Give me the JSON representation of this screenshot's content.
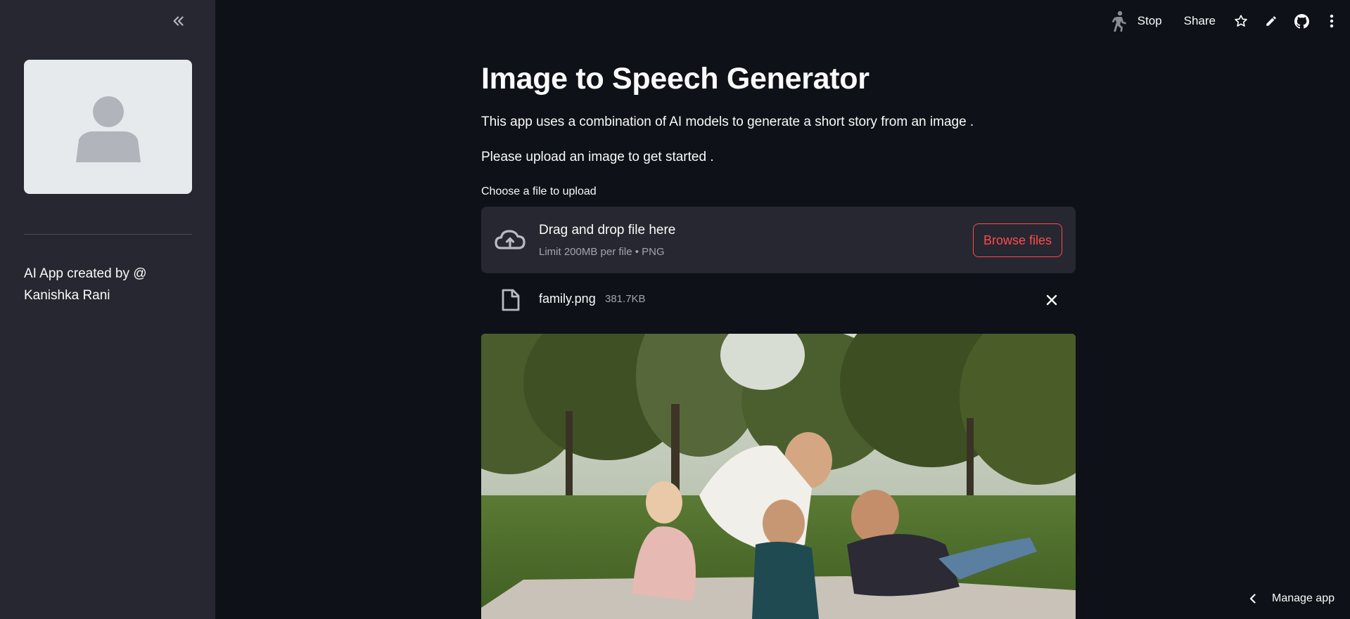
{
  "sidebar": {
    "credit_text": "AI App created by @ Kanishka Rani"
  },
  "header": {
    "stop_label": "Stop",
    "share_label": "Share"
  },
  "main": {
    "title": "Image to Speech Generator",
    "description": "This app uses a combination of AI models to generate a short story from an image .",
    "instruction": "Please upload an image to get started .",
    "uploader": {
      "label": "Choose a file to upload",
      "drag_text": "Drag and drop file here",
      "limit_text": "Limit 200MB per file • PNG",
      "browse_label": "Browse files"
    },
    "uploaded_file": {
      "name": "family.png",
      "size": "381.7KB"
    }
  },
  "footer": {
    "manage_app_label": "Manage app"
  },
  "colors": {
    "background": "#0e1117",
    "sidebar": "#262730",
    "accent": "#ff4b4b",
    "text": "#fafafa"
  }
}
